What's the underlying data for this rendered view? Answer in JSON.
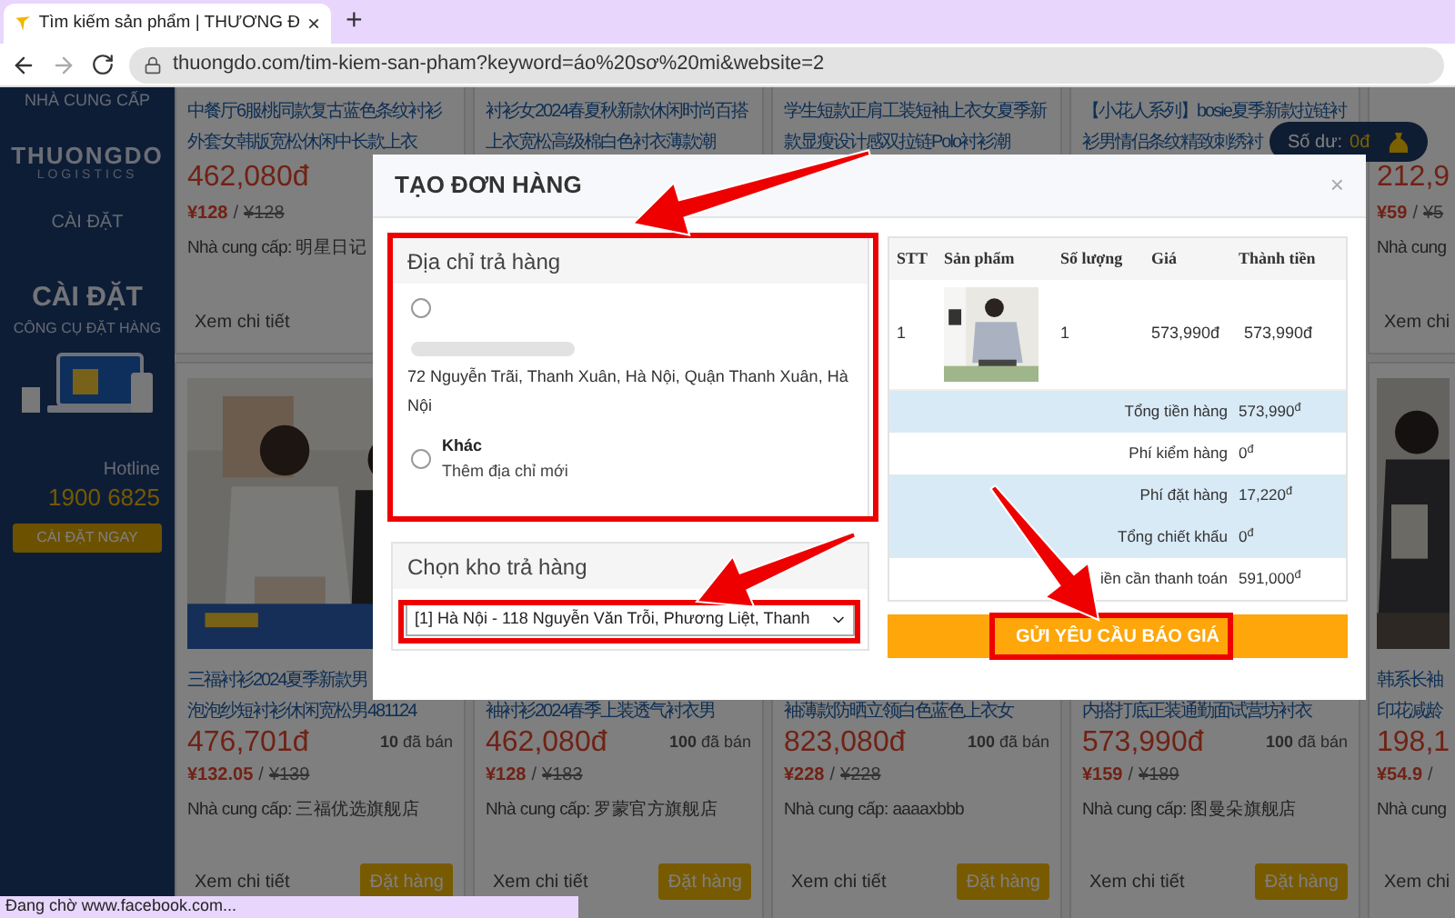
{
  "browser": {
    "tab_title": "Tìm kiếm sản phẩm | THƯƠNG Đ",
    "close": "×",
    "new_tab": "+",
    "url": "thuongdo.com/tim-kiem-san-pham?keyword=áo%20sơ%20mi&website=2"
  },
  "sidebar": {
    "top_label": "NHÀ CUNG CẤP",
    "logo_name": "THUONGDO",
    "logo_sub": "LOGISTICS",
    "settings_label": "CÀI ĐẶT",
    "install_title": "CÀI ĐẶT",
    "install_subtitle": "CÔNG CỤ ĐẶT HÀNG",
    "hotline_label": "Hotline",
    "hotline": "1900 6825",
    "install_button": "CÀI ĐẶT NGAY"
  },
  "balance": {
    "label": "Số dư:",
    "amount": "0đ"
  },
  "product_rows": [
    [
      {
        "title": [
          "中餐厅6服桃同款复古蓝色条纹衬衫",
          "外套女韩版宽松休闲中长款上衣"
        ],
        "price": "462,080đ",
        "yuan": "¥128",
        "separator": "/",
        "yuan_old": "¥128",
        "supplier": "Nhà cung cấp: 明星日记",
        "detail": "Xem chi tiết"
      },
      {
        "title": [
          "衬衫女2024春夏秋新款休闲时尚百搭",
          "上衣宽松高级棉白色衬衣薄款潮"
        ]
      },
      {
        "title": [
          "学生短款正肩工装短袖上衣女夏季新",
          "款显瘦设计感双拉链Polo衬衫潮"
        ]
      },
      {
        "title": [
          "【小花人系列】bosie夏季新款拉链衬",
          "衫男情侣条纹精致刺绣衬"
        ]
      },
      {
        "price": "212,9",
        "yuan": "¥59",
        "separator": "/",
        "yuan_old": "¥5",
        "supplier": "Nhà cung",
        "detail": "Xem chi"
      }
    ],
    [
      {
        "title": [
          "三福衬衫2024夏季新款男",
          "泡泡纱短衬衫休闲宽松男481124"
        ],
        "price": "476,701đ",
        "sold": "**10** đã bán",
        "yuan": "¥132.05",
        "separator": "/",
        "yuan_old": "¥139",
        "supplier": "Nhà cung cấp: 三福优选旗舰店",
        "detail": "Xem chi tiết",
        "order": "Đặt hàng"
      },
      {
        "title": [
          "袖衬衫2024春季上装透气衬衣男"
        ],
        "price": "462,080đ",
        "sold": "**100** đã bán",
        "yuan": "¥128",
        "separator": "/",
        "yuan_old": "¥183",
        "supplier": "Nhà cung cấp: 罗蒙官方旗舰店",
        "detail": "Xem chi tiết",
        "order": "Đặt hàng"
      },
      {
        "title": [
          "袖薄款防晒立领白色蓝色上衣女"
        ],
        "price": "823,080đ",
        "sold": "**100** đã bán",
        "yuan": "¥228",
        "separator": "/",
        "yuan_old": "¥228",
        "supplier": "Nhà cung cấp: aaaaxbbb",
        "detail": "Xem chi tiết",
        "order": "Đặt hàng"
      },
      {
        "title": [
          "内搭打底正装通勤面试营坊衬衣"
        ],
        "price": "573,990đ",
        "sold": "**100** đã bán",
        "yuan": "¥159",
        "separator": "/",
        "yuan_old": "¥189",
        "supplier": "Nhà cung cấp: 图曼朵旗舰店",
        "detail": "Xem chi tiết",
        "order": "Đặt hàng"
      },
      {
        "title": [
          "韩系长袖",
          "印花减龄"
        ],
        "price": "198,1",
        "yuan": "¥54.9",
        "separator": "/",
        "supplier": "Nhà cung",
        "detail": "Xem chi"
      }
    ]
  ],
  "modal": {
    "title": "TẠO ĐƠN HÀNG",
    "close": "×",
    "address_panel": {
      "title": "Địa chỉ trả hàng",
      "options": [
        {
          "kind": "saved",
          "selected": false,
          "address": "72 Nguyễn Trãi, Thanh Xuân, Hà Nội, Quận Thanh Xuân, Hà Nội"
        },
        {
          "kind": "new",
          "selected": false,
          "label": "Khác",
          "address": "Thêm địa chỉ mới"
        }
      ]
    },
    "warehouse_panel": {
      "title": "Chọn kho trả hàng",
      "value": "[1] Hà Nội - 118 Nguyễn Văn Trỗi, Phương Liệt, Thanh"
    },
    "table": {
      "columns": [
        "STT",
        "Sản phẩm",
        "Số lượng",
        "Giá",
        "Thành tiền"
      ],
      "rows": [
        {
          "stt": "1",
          "quantity": "1",
          "price": "573,990đ",
          "total": "573,990đ"
        }
      ],
      "summary": [
        {
          "label": "Tổng tiền hàng",
          "value": "573,990$^{đ}$",
          "shaded": true
        },
        {
          "label": "Phí kiểm hàng",
          "value": "0$^{đ}$",
          "shaded": false
        },
        {
          "label": "Phí đặt hàng",
          "value": "17,220$^{đ}$",
          "shaded": true
        },
        {
          "label": "Tổng chiết khấu",
          "value": "0$^{đ}$",
          "shaded": true
        },
        {
          "label": "iền cần thanh toán",
          "value": "591,000$^{đ}$",
          "shaded": false
        }
      ]
    },
    "submit": "GỬI YÊU CẦU BÁO GIÁ"
  },
  "status_bar": "Đang chờ www.facebook.com..."
}
